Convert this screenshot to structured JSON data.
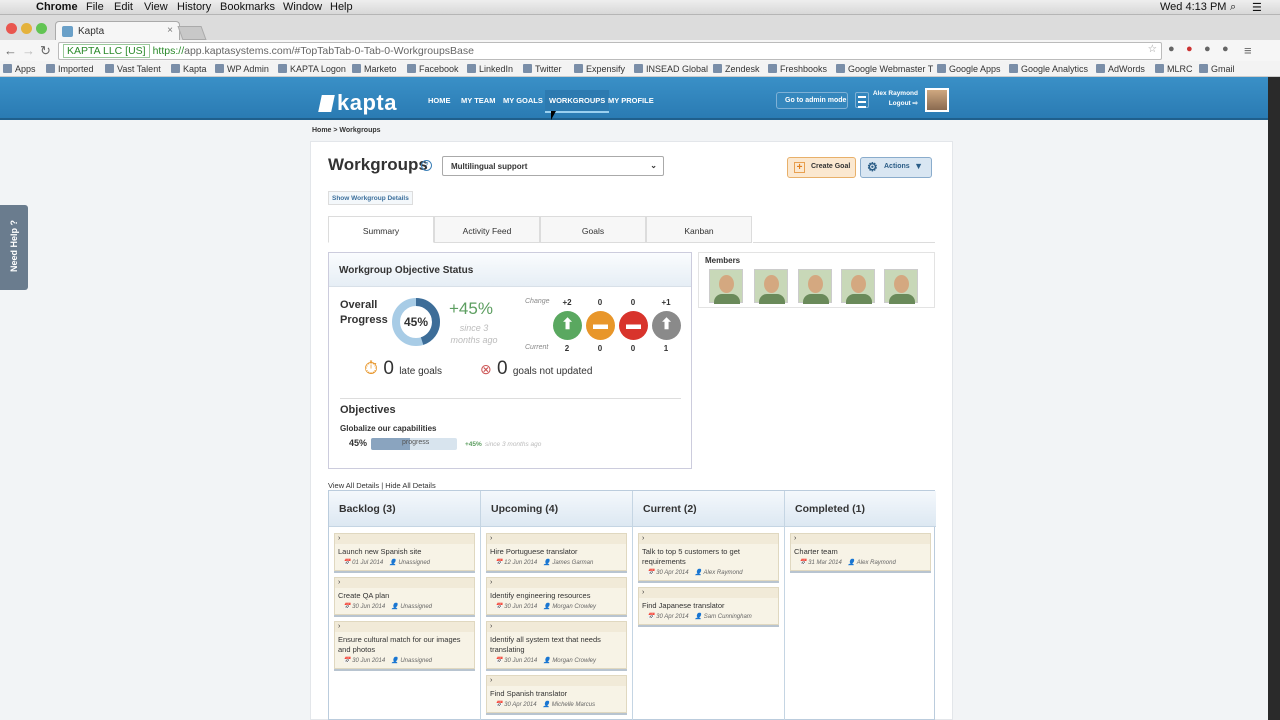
{
  "mac": {
    "apple": "",
    "app": "Chrome",
    "menus": [
      "File",
      "Edit",
      "View",
      "History",
      "Bookmarks",
      "Window",
      "Help"
    ],
    "clock": "Wed 4:13 PM"
  },
  "browser": {
    "tab_title": "Kapta",
    "cert": "KAPTA LLC [US]",
    "url_scheme": "https://",
    "url_rest": "app.kaptasystems.com/#TopTabTab-0-Tab-0-WorkgroupsBase",
    "bookmarks": [
      "Apps",
      "Imported",
      "Vast Talent",
      "Kapta",
      "WP Admin",
      "KAPTA Logon",
      "Marketo",
      "Facebook",
      "LinkedIn",
      "Twitter",
      "Expensify",
      "INSEAD Global",
      "Zendesk",
      "Freshbooks",
      "Google Webmaster T",
      "Google Apps",
      "Google Analytics",
      "AdWords",
      "MLRC",
      "Gmail"
    ]
  },
  "app": {
    "logo": "kapta",
    "nav": [
      "HOME",
      "MY TEAM",
      "MY GOALS",
      "WORKGROUPS",
      "MY PROFILE"
    ],
    "admin_btn": "Go to admin mode",
    "user_name": "Alex Raymond",
    "logout": "Logout"
  },
  "help_tab": "Need Help ?",
  "breadcrumb": "Home > Workgroups",
  "page": {
    "title": "Workgroups",
    "selected_group": "Multilingual support",
    "create_goal": "Create Goal",
    "actions": "Actions",
    "show_details": "Show Workgroup Details",
    "tabs": [
      "Summary",
      "Activity Feed",
      "Goals",
      "Kanban"
    ]
  },
  "status": {
    "title": "Workgroup Objective Status",
    "overall_line1": "Overall",
    "overall_line2": "Progress",
    "overall_pct": "45%",
    "progress_fraction": 0.45,
    "change": "+45%",
    "since": "since 3 months ago",
    "change_label": "Change",
    "current_label": "Current",
    "indicators": [
      {
        "change": "+2",
        "current": "2",
        "color": "#5aa860"
      },
      {
        "change": "0",
        "current": "0",
        "color": "#e8962a"
      },
      {
        "change": "0",
        "current": "0",
        "color": "#d8342c"
      },
      {
        "change": "+1",
        "current": "1",
        "color": "#8a8a8a"
      }
    ],
    "late_count": "0",
    "late_label": "late goals",
    "not_updated_count": "0",
    "not_updated_label": "goals not updated",
    "objectives_title": "Objectives",
    "objective_name": "Globalize our capabilities",
    "objective_pct": "45%",
    "objective_fraction": 0.45,
    "objective_bar_label": "progress",
    "objective_change": "+45%",
    "objective_since": "since 3 months ago"
  },
  "members": {
    "title": "Members",
    "count": 5
  },
  "view_all": "View All Details | Hide All Details",
  "kanban": [
    {
      "title": "Backlog (3)",
      "cards": [
        {
          "name": "Launch new Spanish site",
          "date": "01 Jul 2014",
          "owner": "Unassigned"
        },
        {
          "name": "Create QA plan",
          "date": "30 Jun 2014",
          "owner": "Unassigned"
        },
        {
          "name": "Ensure cultural match for our images and photos",
          "date": "30 Jun 2014",
          "owner": "Unassigned"
        }
      ]
    },
    {
      "title": "Upcoming (4)",
      "cards": [
        {
          "name": "Hire Portuguese translator",
          "date": "12 Jun 2014",
          "owner": "James Garman"
        },
        {
          "name": "Identify engineering resources",
          "date": "30 Jun 2014",
          "owner": "Morgan Crowley"
        },
        {
          "name": "Identify all system text that needs translating",
          "date": "30 Jun 2014",
          "owner": "Morgan Crowley"
        },
        {
          "name": "Find Spanish translator",
          "date": "30 Apr 2014",
          "owner": "Michelle Marcus"
        }
      ]
    },
    {
      "title": "Current (2)",
      "cards": [
        {
          "name": "Talk to top 5 customers to get requirements",
          "date": "30 Apr 2014",
          "owner": "Alex Raymond"
        },
        {
          "name": "Find Japanese translator",
          "date": "30 Apr 2014",
          "owner": "Sam Cunningham"
        }
      ]
    },
    {
      "title": "Completed (1)",
      "cards": [
        {
          "name": "Charter team",
          "date": "31 Mar 2014",
          "owner": "Alex Raymond"
        }
      ]
    }
  ]
}
